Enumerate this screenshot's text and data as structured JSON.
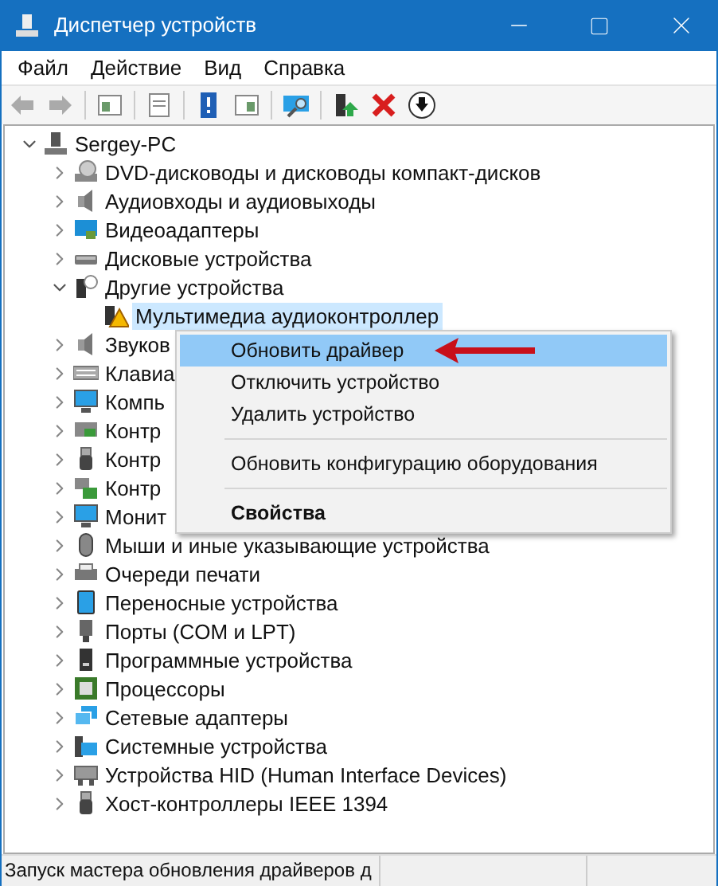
{
  "window": {
    "title": "Диспетчер устройств"
  },
  "menu": [
    "Файл",
    "Действие",
    "Вид",
    "Справка"
  ],
  "tree": {
    "label": "Sergey-PC",
    "kind": "computer",
    "expanded": true,
    "selected": false,
    "children": [
      {
        "label": "DVD-дисководы и дисководы компакт-дисков",
        "kind": "optical",
        "expanded": false,
        "selected": false
      },
      {
        "label": "Аудиовходы и аудиовыходы",
        "kind": "speaker",
        "expanded": false,
        "selected": false
      },
      {
        "label": "Видеоадаптеры",
        "kind": "display",
        "expanded": false,
        "selected": false
      },
      {
        "label": "Дисковые устройства",
        "kind": "drive",
        "expanded": false,
        "selected": false
      },
      {
        "label": "Другие устройства",
        "kind": "unknown",
        "expanded": true,
        "selected": false,
        "children": [
          {
            "label": "Мультимедиа аудиоконтроллер",
            "kind": "warning",
            "selected": true
          }
        ]
      },
      {
        "label": "Звуков",
        "kind": "speaker",
        "expanded": false,
        "selected": false
      },
      {
        "label": "Клавиа",
        "kind": "keyboard",
        "expanded": false,
        "selected": false
      },
      {
        "label": "Компь",
        "kind": "monitor",
        "expanded": false,
        "selected": false
      },
      {
        "label": "Контр",
        "kind": "storage",
        "expanded": false,
        "selected": false
      },
      {
        "label": "Контр",
        "kind": "usb",
        "expanded": false,
        "selected": false
      },
      {
        "label": "Контр",
        "kind": "bus",
        "expanded": false,
        "selected": false
      },
      {
        "label": "Монит",
        "kind": "monitor",
        "expanded": false,
        "selected": false
      },
      {
        "label": "Мыши и иные указывающие устройства",
        "kind": "mouse",
        "expanded": false,
        "selected": false
      },
      {
        "label": "Очереди печати",
        "kind": "printer",
        "expanded": false,
        "selected": false
      },
      {
        "label": "Переносные устройства",
        "kind": "portable",
        "expanded": false,
        "selected": false
      },
      {
        "label": "Порты (COM и LPT)",
        "kind": "port",
        "expanded": false,
        "selected": false
      },
      {
        "label": "Программные устройства",
        "kind": "firmware",
        "expanded": false,
        "selected": false
      },
      {
        "label": "Процессоры",
        "kind": "processor",
        "expanded": false,
        "selected": false
      },
      {
        "label": "Сетевые адаптеры",
        "kind": "network",
        "expanded": false,
        "selected": false
      },
      {
        "label": "Системные устройства",
        "kind": "system",
        "expanded": false,
        "selected": false
      },
      {
        "label": "Устройства HID (Human Interface Devices)",
        "kind": "hid",
        "expanded": false,
        "selected": false
      },
      {
        "label": "Хост-контроллеры IEEE 1394",
        "kind": "usb",
        "expanded": false,
        "selected": false
      }
    ]
  },
  "context_menu": {
    "items": [
      {
        "kind": "item",
        "label": "Обновить драйвер",
        "selected": true,
        "default": false
      },
      {
        "kind": "item",
        "label": "Отключить устройство",
        "selected": false,
        "default": false
      },
      {
        "kind": "item",
        "label": "Удалить устройство",
        "selected": false,
        "default": false
      },
      {
        "kind": "separator"
      },
      {
        "kind": "item",
        "label": "Обновить конфигурацию оборудования",
        "selected": false,
        "default": false
      },
      {
        "kind": "separator"
      },
      {
        "kind": "item",
        "label": "Свойства",
        "selected": false,
        "default": true
      }
    ]
  },
  "status_bar": {
    "text": "Запуск мастера обновления драйверов д"
  }
}
